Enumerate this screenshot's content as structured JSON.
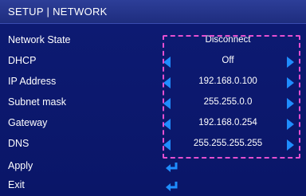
{
  "header": {
    "title": "SETUP | NETWORK"
  },
  "rows": [
    {
      "label": "Network State",
      "value": "Disconnect"
    },
    {
      "label": "DHCP",
      "value": "Off"
    },
    {
      "label": "IP Address",
      "value": "192.168.0.100"
    },
    {
      "label": "Subnet mask",
      "value": "255.255.0.0"
    },
    {
      "label": "Gateway",
      "value": "192.168.0.254"
    },
    {
      "label": "DNS",
      "value": "255.255.255.255"
    },
    {
      "label": "Apply",
      "icon": "enter-icon"
    },
    {
      "label": "Exit",
      "icon": "enter-icon"
    }
  ],
  "colors": {
    "header_bg": "#23349a",
    "panel_bg": "#0c1870",
    "arrow": "#1f8dff",
    "selection_border": "#e54fd0"
  }
}
